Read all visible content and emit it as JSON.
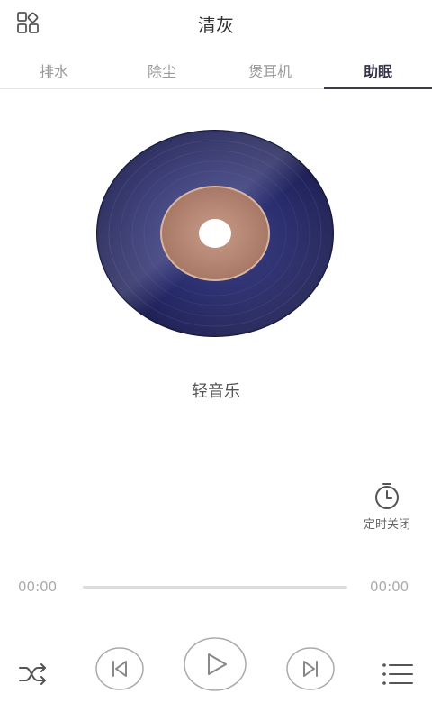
{
  "header": {
    "title": "清灰",
    "apps_icon": "apps-grid-icon"
  },
  "tabs": [
    {
      "label": "排水",
      "active": false
    },
    {
      "label": "除尘",
      "active": false
    },
    {
      "label": "煲耳机",
      "active": false
    },
    {
      "label": "助眠",
      "active": true
    }
  ],
  "player": {
    "track_name": "轻音乐",
    "timer_label": "定时关闭",
    "current_time": "00:00",
    "total_time": "00:00",
    "progress": 0,
    "icons": {
      "shuffle": "shuffle-icon",
      "previous": "previous-icon",
      "play": "play-icon",
      "next": "next-icon",
      "playlist": "playlist-icon",
      "timer": "timer-icon"
    }
  },
  "colors": {
    "disc_dark": "#23255e",
    "disc_label": "#b98a77",
    "active_tab": "#333347",
    "inactive_tab": "#999999"
  }
}
